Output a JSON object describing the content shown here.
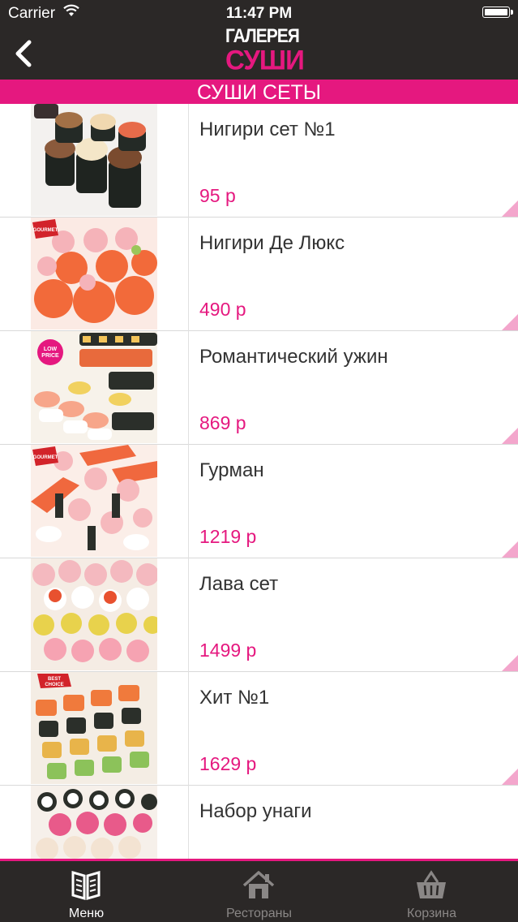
{
  "status_bar": {
    "carrier": "Carrier",
    "time": "11:47 PM"
  },
  "nav": {
    "logo_line1": "ГАЛЕРЕЯ",
    "logo_line2": "СУШИ"
  },
  "section_title": "СУШИ СЕТЫ",
  "items": [
    {
      "name": "Нигири сет №1",
      "price": "95 р"
    },
    {
      "name": "Нигири Де Люкс",
      "price": "490 р",
      "badge": "GOURMET"
    },
    {
      "name": "Романтический ужин",
      "price": "869 р",
      "badge": "LOW PRICE"
    },
    {
      "name": "Гурман",
      "price": "1219 р",
      "badge": "GOURMET"
    },
    {
      "name": "Лава сет",
      "price": "1499 р"
    },
    {
      "name": "Хит №1",
      "price": "1629 р",
      "badge": "BEST CHOICE"
    },
    {
      "name": "Набор унаги",
      "price": ""
    }
  ],
  "tabs": [
    {
      "label": "Меню",
      "icon": "menu-book-icon",
      "active": true
    },
    {
      "label": "Рестораны",
      "icon": "house-icon",
      "active": false
    },
    {
      "label": "Корзина",
      "icon": "basket-icon",
      "active": false
    }
  ],
  "colors": {
    "accent": "#e5187f",
    "bar": "#2b2827"
  }
}
